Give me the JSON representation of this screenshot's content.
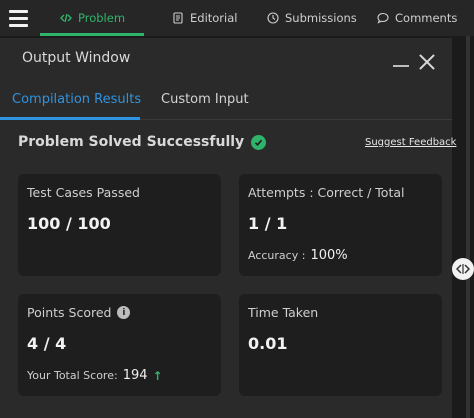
{
  "nav": {
    "tabs": [
      {
        "label": "Problem",
        "icon": "code-icon",
        "active": true
      },
      {
        "label": "Editorial",
        "icon": "document-icon"
      },
      {
        "label": "Submissions",
        "icon": "clock-icon"
      },
      {
        "label": "Comments",
        "icon": "comment-icon"
      }
    ]
  },
  "output": {
    "title": "Output Window",
    "tabs": [
      "Compilation Results",
      "Custom Input"
    ],
    "status": "Problem Solved Successfully",
    "feedback_link": "Suggest Feedback"
  },
  "cards": {
    "test_cases": {
      "label": "Test Cases Passed",
      "value": "100 / 100"
    },
    "attempts": {
      "label": "Attempts : Correct / Total",
      "value": "1 / 1",
      "accuracy_label": "Accuracy :",
      "accuracy_value": "100%"
    },
    "points": {
      "label": "Points Scored",
      "value": "4 / 4",
      "total_label": "Your Total Score:",
      "total_value": "194"
    },
    "time": {
      "label": "Time Taken",
      "value": "0.01"
    }
  },
  "colors": {
    "accent_green": "#2fb36b",
    "accent_blue": "#2e93e0",
    "panel_bg": "#2a2a2a",
    "card_bg": "#1e1e1e"
  }
}
